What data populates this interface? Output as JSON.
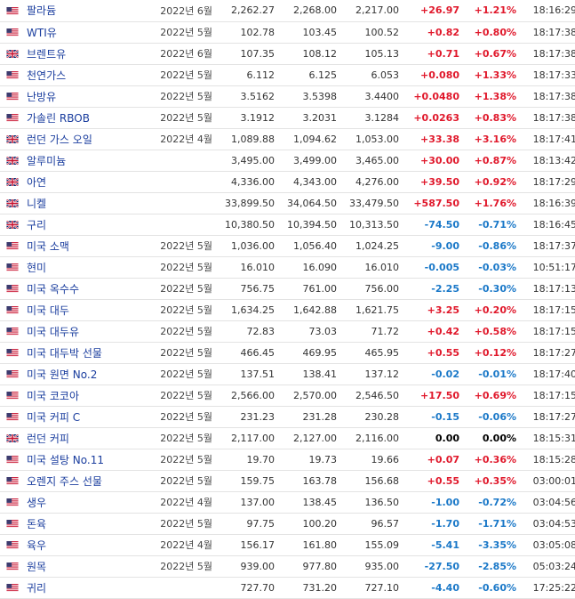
{
  "colors": {
    "up": "#e0182b",
    "down": "#1a78c8",
    "link": "#1a3d9e",
    "open_clock": "#2e9e2e",
    "closed_clock": "#d92b2b"
  },
  "rows": [
    {
      "flag": "us",
      "name": "팔라듐",
      "month": "2022년 6월",
      "last": "2,262.27",
      "high": "2,268.00",
      "low": "2,217.00",
      "change": "+26.97",
      "pct": "+1.21%",
      "time": "18:16:29",
      "dir": "up",
      "status": "open"
    },
    {
      "flag": "us",
      "name": "WTI유",
      "month": "2022년 5월",
      "last": "102.78",
      "high": "103.45",
      "low": "100.52",
      "change": "+0.82",
      "pct": "+0.80%",
      "time": "18:17:38",
      "dir": "up",
      "status": "open"
    },
    {
      "flag": "uk",
      "name": "브렌트유",
      "month": "2022년 6월",
      "last": "107.35",
      "high": "108.12",
      "low": "105.13",
      "change": "+0.71",
      "pct": "+0.67%",
      "time": "18:17:38",
      "dir": "up",
      "status": "open"
    },
    {
      "flag": "us",
      "name": "천연가스",
      "month": "2022년 5월",
      "last": "6.112",
      "high": "6.125",
      "low": "6.053",
      "change": "+0.080",
      "pct": "+1.33%",
      "time": "18:17:33",
      "dir": "up",
      "status": "open"
    },
    {
      "flag": "us",
      "name": "난방유",
      "month": "2022년 5월",
      "last": "3.5162",
      "high": "3.5398",
      "low": "3.4400",
      "change": "+0.0480",
      "pct": "+1.38%",
      "time": "18:17:38",
      "dir": "up",
      "status": "open"
    },
    {
      "flag": "us",
      "name": "가솔린 RBOB",
      "month": "2022년 5월",
      "last": "3.1912",
      "high": "3.2031",
      "low": "3.1284",
      "change": "+0.0263",
      "pct": "+0.83%",
      "time": "18:17:38",
      "dir": "up",
      "status": "open"
    },
    {
      "flag": "uk",
      "name": "런던 가스 오일",
      "month": "2022년 4월",
      "last": "1,089.88",
      "high": "1,094.62",
      "low": "1,053.00",
      "change": "+33.38",
      "pct": "+3.16%",
      "time": "18:17:41",
      "dir": "up",
      "status": "open"
    },
    {
      "flag": "uk",
      "name": "알루미늄",
      "month": "",
      "last": "3,495.00",
      "high": "3,499.00",
      "low": "3,465.00",
      "change": "+30.00",
      "pct": "+0.87%",
      "time": "18:13:42",
      "dir": "up",
      "status": "open"
    },
    {
      "flag": "uk",
      "name": "아연",
      "month": "",
      "last": "4,336.00",
      "high": "4,343.00",
      "low": "4,276.00",
      "change": "+39.50",
      "pct": "+0.92%",
      "time": "18:17:29",
      "dir": "up",
      "status": "open"
    },
    {
      "flag": "uk",
      "name": "니켈",
      "month": "",
      "last": "33,899.50",
      "high": "34,064.50",
      "low": "33,479.50",
      "change": "+587.50",
      "pct": "+1.76%",
      "time": "18:16:39",
      "dir": "up",
      "status": "open"
    },
    {
      "flag": "uk",
      "name": "구리",
      "month": "",
      "last": "10,380.50",
      "high": "10,394.50",
      "low": "10,313.50",
      "change": "-74.50",
      "pct": "-0.71%",
      "time": "18:16:45",
      "dir": "down",
      "status": "open"
    },
    {
      "flag": "us",
      "name": "미국 소맥",
      "month": "2022년 5월",
      "last": "1,036.00",
      "high": "1,056.40",
      "low": "1,024.25",
      "change": "-9.00",
      "pct": "-0.86%",
      "time": "18:17:37",
      "dir": "down",
      "status": "open"
    },
    {
      "flag": "us",
      "name": "현미",
      "month": "2022년 5월",
      "last": "16.010",
      "high": "16.090",
      "low": "16.010",
      "change": "-0.005",
      "pct": "-0.03%",
      "time": "10:51:17",
      "dir": "down",
      "status": "open"
    },
    {
      "flag": "us",
      "name": "미국 옥수수",
      "month": "2022년 5월",
      "last": "756.75",
      "high": "761.00",
      "low": "756.00",
      "change": "-2.25",
      "pct": "-0.30%",
      "time": "18:17:13",
      "dir": "down",
      "status": "open"
    },
    {
      "flag": "us",
      "name": "미국 대두",
      "month": "2022년 5월",
      "last": "1,634.25",
      "high": "1,642.88",
      "low": "1,621.75",
      "change": "+3.25",
      "pct": "+0.20%",
      "time": "18:17:15",
      "dir": "up",
      "status": "open"
    },
    {
      "flag": "us",
      "name": "미국 대두유",
      "month": "2022년 5월",
      "last": "72.83",
      "high": "73.03",
      "low": "71.72",
      "change": "+0.42",
      "pct": "+0.58%",
      "time": "18:17:15",
      "dir": "up",
      "status": "open"
    },
    {
      "flag": "us",
      "name": "미국 대두박 선물",
      "month": "2022년 5월",
      "last": "466.45",
      "high": "469.95",
      "low": "465.95",
      "change": "+0.55",
      "pct": "+0.12%",
      "time": "18:17:27",
      "dir": "up",
      "status": "open"
    },
    {
      "flag": "us",
      "name": "미국 원면 No.2",
      "month": "2022년 5월",
      "last": "137.51",
      "high": "138.41",
      "low": "137.12",
      "change": "-0.02",
      "pct": "-0.01%",
      "time": "18:17:40",
      "dir": "down",
      "status": "open"
    },
    {
      "flag": "us",
      "name": "미국 코코아",
      "month": "2022년 5월",
      "last": "2,566.00",
      "high": "2,570.00",
      "low": "2,546.50",
      "change": "+17.50",
      "pct": "+0.69%",
      "time": "18:17:15",
      "dir": "up",
      "status": "closed"
    },
    {
      "flag": "us",
      "name": "미국 커피 C",
      "month": "2022년 5월",
      "last": "231.23",
      "high": "231.28",
      "low": "230.28",
      "change": "-0.15",
      "pct": "-0.06%",
      "time": "18:17:27",
      "dir": "down",
      "status": "open"
    },
    {
      "flag": "uk",
      "name": "런던 커피",
      "month": "2022년 5월",
      "last": "2,117.00",
      "high": "2,127.00",
      "low": "2,116.00",
      "change": "0.00",
      "pct": "0.00%",
      "time": "18:15:31",
      "dir": "flat",
      "status": "open"
    },
    {
      "flag": "us",
      "name": "미국 설탕 No.11",
      "month": "2022년 5월",
      "last": "19.70",
      "high": "19.73",
      "low": "19.66",
      "change": "+0.07",
      "pct": "+0.36%",
      "time": "18:15:28",
      "dir": "up",
      "status": "open"
    },
    {
      "flag": "us",
      "name": "오렌지 주스 선물",
      "month": "2022년 5월",
      "last": "159.75",
      "high": "163.78",
      "low": "156.68",
      "change": "+0.55",
      "pct": "+0.35%",
      "time": "03:00:01",
      "dir": "up",
      "status": "closed"
    },
    {
      "flag": "us",
      "name": "생우",
      "month": "2022년 4월",
      "last": "137.00",
      "high": "138.45",
      "low": "136.50",
      "change": "-1.00",
      "pct": "-0.72%",
      "time": "03:04:56",
      "dir": "down",
      "status": "closed"
    },
    {
      "flag": "us",
      "name": "돈육",
      "month": "2022년 5월",
      "last": "97.75",
      "high": "100.20",
      "low": "96.57",
      "change": "-1.70",
      "pct": "-1.71%",
      "time": "03:04:53",
      "dir": "down",
      "status": "closed"
    },
    {
      "flag": "us",
      "name": "육우",
      "month": "2022년 4월",
      "last": "156.17",
      "high": "161.80",
      "low": "155.09",
      "change": "-5.41",
      "pct": "-3.35%",
      "time": "03:05:08",
      "dir": "down",
      "status": "closed"
    },
    {
      "flag": "us",
      "name": "원목",
      "month": "2022년 5월",
      "last": "939.00",
      "high": "977.80",
      "low": "935.00",
      "change": "-27.50",
      "pct": "-2.85%",
      "time": "05:03:24",
      "dir": "down",
      "status": "closed"
    },
    {
      "flag": "us",
      "name": "귀리",
      "month": "",
      "last": "727.70",
      "high": "731.20",
      "low": "727.10",
      "change": "-4.40",
      "pct": "-0.60%",
      "time": "17:25:22",
      "dir": "down",
      "status": "closed"
    }
  ]
}
